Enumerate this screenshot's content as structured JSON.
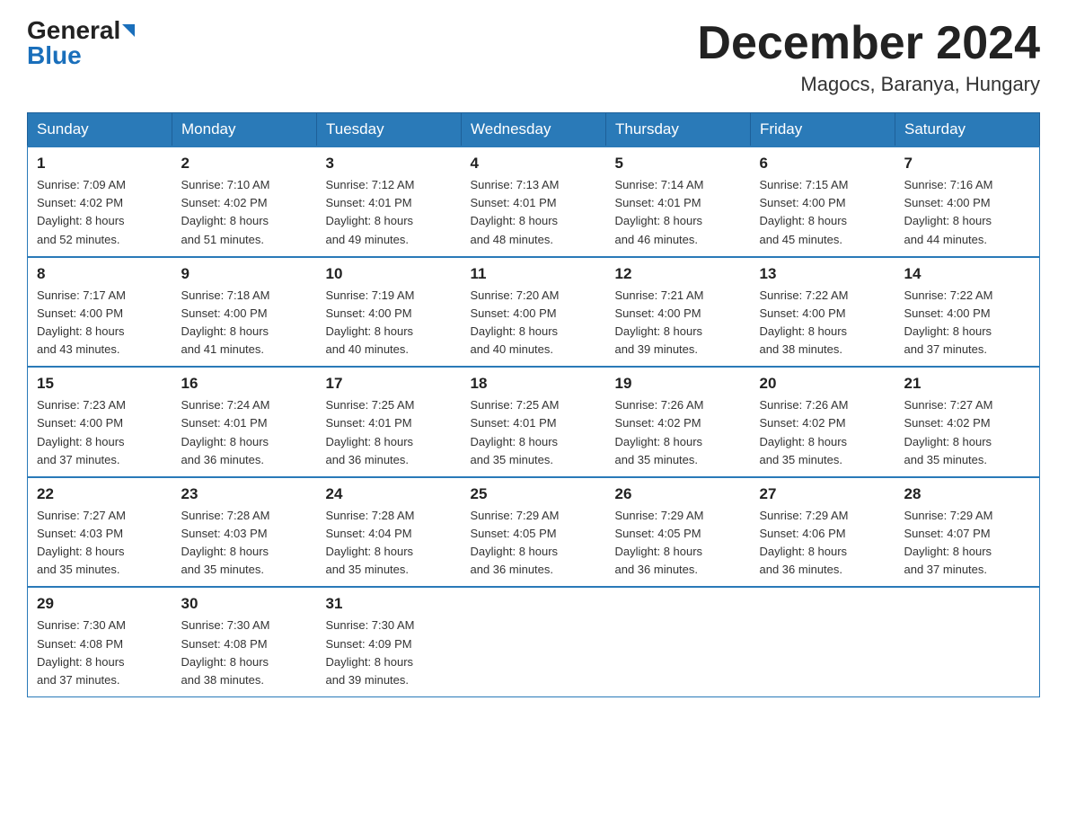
{
  "header": {
    "logo_general": "General",
    "logo_blue": "Blue",
    "title": "December 2024",
    "subtitle": "Magocs, Baranya, Hungary"
  },
  "weekdays": [
    "Sunday",
    "Monday",
    "Tuesday",
    "Wednesday",
    "Thursday",
    "Friday",
    "Saturday"
  ],
  "weeks": [
    [
      {
        "day": "1",
        "sunrise": "7:09 AM",
        "sunset": "4:02 PM",
        "daylight": "8 hours and 52 minutes."
      },
      {
        "day": "2",
        "sunrise": "7:10 AM",
        "sunset": "4:02 PM",
        "daylight": "8 hours and 51 minutes."
      },
      {
        "day": "3",
        "sunrise": "7:12 AM",
        "sunset": "4:01 PM",
        "daylight": "8 hours and 49 minutes."
      },
      {
        "day": "4",
        "sunrise": "7:13 AM",
        "sunset": "4:01 PM",
        "daylight": "8 hours and 48 minutes."
      },
      {
        "day": "5",
        "sunrise": "7:14 AM",
        "sunset": "4:01 PM",
        "daylight": "8 hours and 46 minutes."
      },
      {
        "day": "6",
        "sunrise": "7:15 AM",
        "sunset": "4:00 PM",
        "daylight": "8 hours and 45 minutes."
      },
      {
        "day": "7",
        "sunrise": "7:16 AM",
        "sunset": "4:00 PM",
        "daylight": "8 hours and 44 minutes."
      }
    ],
    [
      {
        "day": "8",
        "sunrise": "7:17 AM",
        "sunset": "4:00 PM",
        "daylight": "8 hours and 43 minutes."
      },
      {
        "day": "9",
        "sunrise": "7:18 AM",
        "sunset": "4:00 PM",
        "daylight": "8 hours and 41 minutes."
      },
      {
        "day": "10",
        "sunrise": "7:19 AM",
        "sunset": "4:00 PM",
        "daylight": "8 hours and 40 minutes."
      },
      {
        "day": "11",
        "sunrise": "7:20 AM",
        "sunset": "4:00 PM",
        "daylight": "8 hours and 40 minutes."
      },
      {
        "day": "12",
        "sunrise": "7:21 AM",
        "sunset": "4:00 PM",
        "daylight": "8 hours and 39 minutes."
      },
      {
        "day": "13",
        "sunrise": "7:22 AM",
        "sunset": "4:00 PM",
        "daylight": "8 hours and 38 minutes."
      },
      {
        "day": "14",
        "sunrise": "7:22 AM",
        "sunset": "4:00 PM",
        "daylight": "8 hours and 37 minutes."
      }
    ],
    [
      {
        "day": "15",
        "sunrise": "7:23 AM",
        "sunset": "4:00 PM",
        "daylight": "8 hours and 37 minutes."
      },
      {
        "day": "16",
        "sunrise": "7:24 AM",
        "sunset": "4:01 PM",
        "daylight": "8 hours and 36 minutes."
      },
      {
        "day": "17",
        "sunrise": "7:25 AM",
        "sunset": "4:01 PM",
        "daylight": "8 hours and 36 minutes."
      },
      {
        "day": "18",
        "sunrise": "7:25 AM",
        "sunset": "4:01 PM",
        "daylight": "8 hours and 35 minutes."
      },
      {
        "day": "19",
        "sunrise": "7:26 AM",
        "sunset": "4:02 PM",
        "daylight": "8 hours and 35 minutes."
      },
      {
        "day": "20",
        "sunrise": "7:26 AM",
        "sunset": "4:02 PM",
        "daylight": "8 hours and 35 minutes."
      },
      {
        "day": "21",
        "sunrise": "7:27 AM",
        "sunset": "4:02 PM",
        "daylight": "8 hours and 35 minutes."
      }
    ],
    [
      {
        "day": "22",
        "sunrise": "7:27 AM",
        "sunset": "4:03 PM",
        "daylight": "8 hours and 35 minutes."
      },
      {
        "day": "23",
        "sunrise": "7:28 AM",
        "sunset": "4:03 PM",
        "daylight": "8 hours and 35 minutes."
      },
      {
        "day": "24",
        "sunrise": "7:28 AM",
        "sunset": "4:04 PM",
        "daylight": "8 hours and 35 minutes."
      },
      {
        "day": "25",
        "sunrise": "7:29 AM",
        "sunset": "4:05 PM",
        "daylight": "8 hours and 36 minutes."
      },
      {
        "day": "26",
        "sunrise": "7:29 AM",
        "sunset": "4:05 PM",
        "daylight": "8 hours and 36 minutes."
      },
      {
        "day": "27",
        "sunrise": "7:29 AM",
        "sunset": "4:06 PM",
        "daylight": "8 hours and 36 minutes."
      },
      {
        "day": "28",
        "sunrise": "7:29 AM",
        "sunset": "4:07 PM",
        "daylight": "8 hours and 37 minutes."
      }
    ],
    [
      {
        "day": "29",
        "sunrise": "7:30 AM",
        "sunset": "4:08 PM",
        "daylight": "8 hours and 37 minutes."
      },
      {
        "day": "30",
        "sunrise": "7:30 AM",
        "sunset": "4:08 PM",
        "daylight": "8 hours and 38 minutes."
      },
      {
        "day": "31",
        "sunrise": "7:30 AM",
        "sunset": "4:09 PM",
        "daylight": "8 hours and 39 minutes."
      },
      null,
      null,
      null,
      null
    ]
  ],
  "labels": {
    "sunrise_prefix": "Sunrise: ",
    "sunset_prefix": "Sunset: ",
    "daylight_prefix": "Daylight: "
  }
}
